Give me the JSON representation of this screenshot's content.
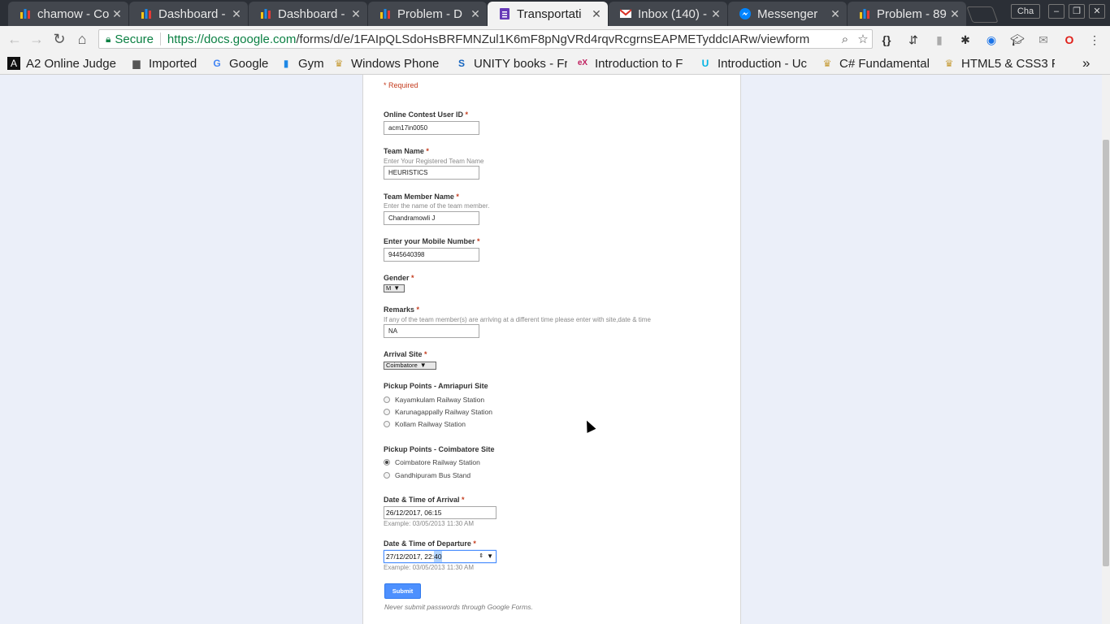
{
  "tabs": [
    {
      "title": "chamow - Co",
      "icon": "bar-chart-favicon",
      "active": false
    },
    {
      "title": "Dashboard -",
      "icon": "bar-chart-favicon",
      "active": false
    },
    {
      "title": "Dashboard -",
      "icon": "bar-chart-favicon",
      "active": false
    },
    {
      "title": "Problem - D",
      "icon": "bar-chart-favicon",
      "active": false
    },
    {
      "title": "Transportati",
      "icon": "google-forms-favicon",
      "active": true
    },
    {
      "title": "Inbox (140) -",
      "icon": "gmail-favicon",
      "active": false
    },
    {
      "title": "Messenger",
      "icon": "messenger-favicon",
      "active": false
    },
    {
      "title": "Problem - 89",
      "icon": "bar-chart-favicon",
      "active": false
    }
  ],
  "profile_label": "Cha",
  "toolbar": {
    "secure_label": "Secure",
    "url_prefix": "https://docs.google.com",
    "url_rest": "/forms/d/e/1FAIpQLSdoHsBRFMNZul1K6mF8pNgVRd4rqvRcgrnsEAPMETyddcIARw/viewform"
  },
  "bookmarks": [
    {
      "label": "A2 Online Judge",
      "icon": "a2-icon"
    },
    {
      "label": "Imported",
      "icon": "folder-icon"
    },
    {
      "label": "Google",
      "icon": "google-icon"
    },
    {
      "label": "Gym",
      "icon": "bar-chart-icon"
    },
    {
      "label": "Windows Phone",
      "icon": "page-icon"
    },
    {
      "label": "UNITY books - Fr",
      "icon": "s-icon"
    },
    {
      "label": "Introduction to F",
      "icon": "edx-icon"
    },
    {
      "label": "Introduction - Uc",
      "icon": "udacity-icon"
    },
    {
      "label": "C# Fundamental",
      "icon": "page-icon"
    },
    {
      "label": "HTML5 & CSS3 Fu",
      "icon": "page-icon"
    }
  ],
  "overflow_label": "»",
  "form": {
    "required_note": "* Required",
    "star": "*",
    "user_id": {
      "title": "Online Contest User ID",
      "value": "acm17in0050"
    },
    "team_name": {
      "title": "Team Name",
      "help": "Enter Your Registered Team Name",
      "value": "HEURISTICS"
    },
    "member_name": {
      "title": "Team Member Name",
      "help": "Enter the name of the team member.",
      "value": "Chandramowli J"
    },
    "mobile": {
      "title": "Enter your Mobile Number",
      "value": "9445640398"
    },
    "gender": {
      "title": "Gender",
      "value": "M"
    },
    "remarks": {
      "title": "Remarks",
      "help": "If any of the team member(s) are arriving at a different time please enter with site,date & time",
      "value": "NA"
    },
    "arrival_site": {
      "title": "Arrival Site",
      "value": "Coimbatore"
    },
    "pickup_amrita": {
      "title": "Pickup Points - Amriapuri Site",
      "options": [
        "Kayamkulam Railway Station",
        "Karunagappally Railway Station",
        "Kollam Railway Station"
      ]
    },
    "pickup_cbe": {
      "title": "Pickup Points - Coimbatore Site",
      "options": [
        "Coimbatore Railway Station",
        "Gandhipuram Bus Stand"
      ],
      "selected": 0
    },
    "arrival": {
      "title": "Date & Time of Arrival",
      "value": "26/12/2017, 06:15",
      "example": "Example: 03/05/2013 11:30 AM"
    },
    "departure": {
      "title": "Date & Time of Departure",
      "value_main": "27/12/2017, 22:",
      "value_sel": "40",
      "example": "Example: 03/05/2013 11:30 AM"
    },
    "submit_label": "Submit",
    "footer_note": "Never submit passwords through Google Forms."
  }
}
